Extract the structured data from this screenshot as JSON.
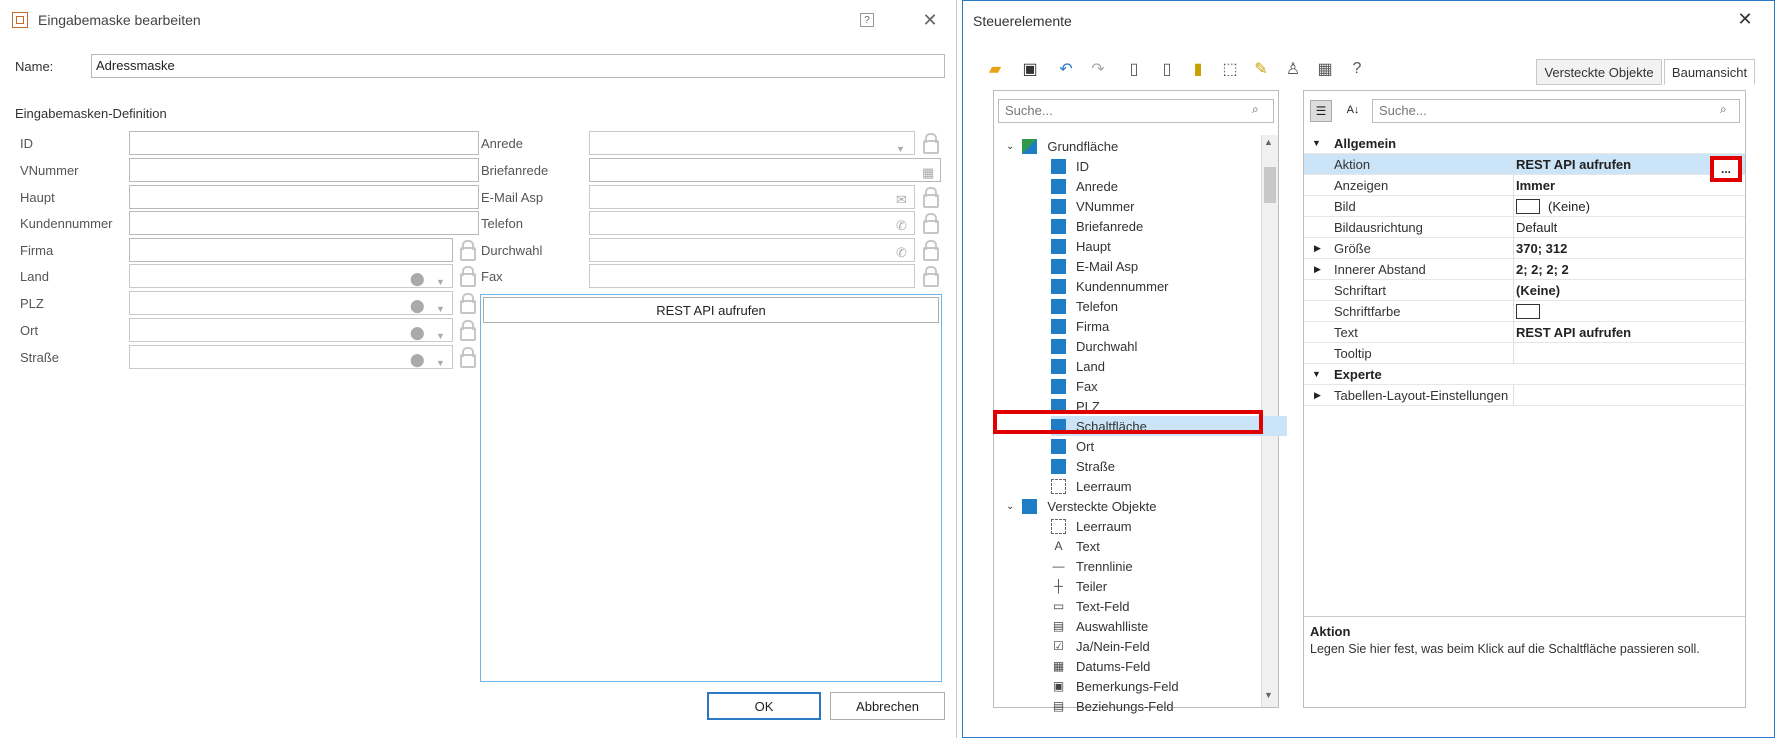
{
  "left": {
    "title": "Eingabemaske bearbeiten",
    "help": "?",
    "close": "✕",
    "name_label": "Name:",
    "name_value": "Adressmaske",
    "section": "Eingabemasken-Definition",
    "col1": [
      "ID",
      "VNummer",
      "Haupt",
      "Kundennummer",
      "Firma",
      "Land",
      "PLZ",
      "Ort",
      "Straße"
    ],
    "col2": [
      "Anrede",
      "Briefanrede",
      "E-Mail Asp",
      "Telefon",
      "Durchwahl",
      "Fax"
    ],
    "rest_button": "REST API aufrufen",
    "ok": "OK",
    "cancel": "Abbrechen"
  },
  "right": {
    "title": "Steuerelemente",
    "close": "✕",
    "tabs": [
      "Versteckte Objekte",
      "Baumansicht"
    ],
    "search_placeholder_tree": "Suche...",
    "search_placeholder_props": "Suche...",
    "tree": {
      "root1": "Grundfläche",
      "items1": [
        "ID",
        "Anrede",
        "VNummer",
        "Briefanrede",
        "Haupt",
        "E-Mail Asp",
        "Kundennummer",
        "Telefon",
        "Firma",
        "Durchwahl",
        "Land",
        "Fax",
        "PLZ",
        "Schaltfläche",
        "Ort",
        "Straße",
        "Leerraum"
      ],
      "root2": "Versteckte Objekte",
      "items2": [
        "Leerraum",
        "Text",
        "Trennlinie",
        "Teiler",
        "Text-Feld",
        "Auswahlliste",
        "Ja/Nein-Feld",
        "Datums-Feld",
        "Bemerkungs-Feld",
        "Beziehungs-Feld"
      ]
    },
    "props": {
      "cat1": "Allgemein",
      "rows": [
        {
          "name": "Aktion",
          "value": "REST API aufrufen"
        },
        {
          "name": "Anzeigen",
          "value": "Immer"
        },
        {
          "name": "Bild",
          "value": "(Keine)"
        },
        {
          "name": "Bildausrichtung",
          "value": "Default"
        },
        {
          "name": "Größe",
          "value": "370; 312"
        },
        {
          "name": "Innerer Abstand",
          "value": "2; 2; 2; 2"
        },
        {
          "name": "Schriftart",
          "value": "(Keine)"
        },
        {
          "name": "Schriftfarbe",
          "value": ""
        },
        {
          "name": "Text",
          "value": "REST API aufrufen"
        },
        {
          "name": "Tooltip",
          "value": ""
        }
      ],
      "cat2": "Experte",
      "row_exp": "Tabellen-Layout-Einstellungen",
      "ellipsis": "...",
      "desc_title": "Aktion",
      "desc_text": "Legen Sie hier fest, was beim Klick auf die Schaltfläche passieren soll."
    }
  },
  "colors": {
    "accent": "#1f7dc6",
    "highlight": "#e00000",
    "selection": "#cce4f7"
  }
}
